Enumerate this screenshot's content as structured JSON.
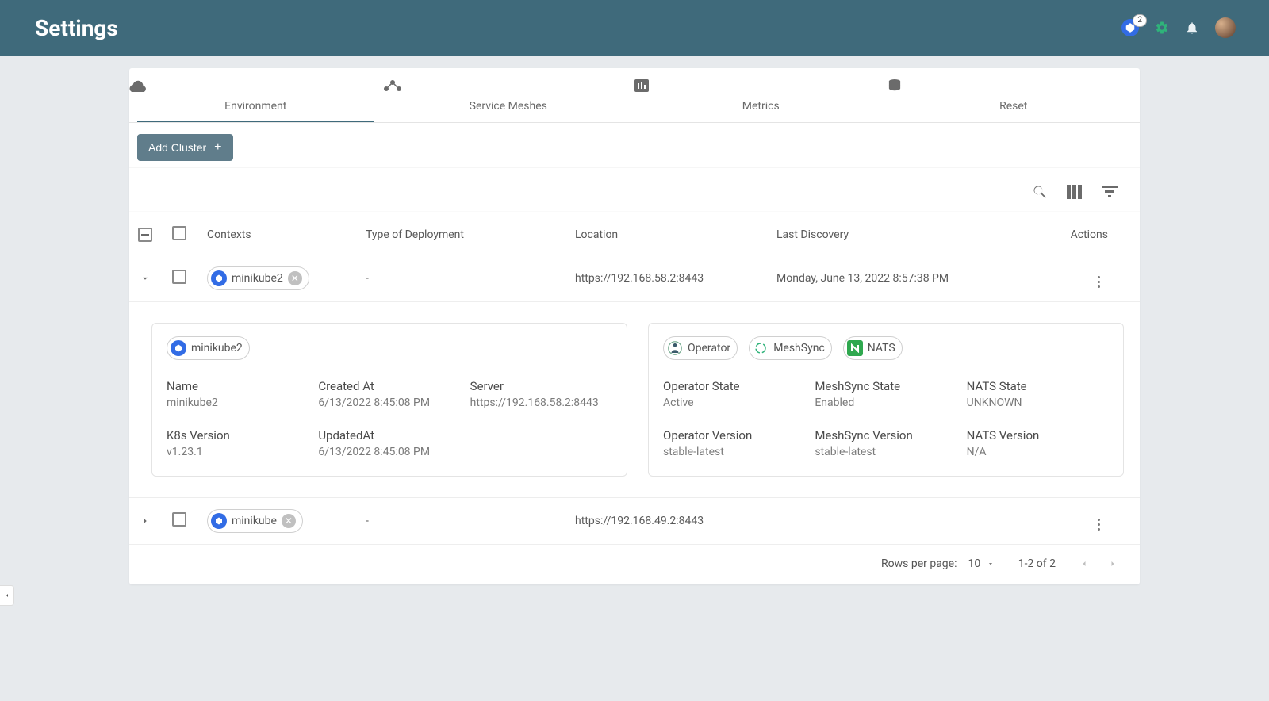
{
  "header": {
    "title": "Settings",
    "k8s_badge_count": "2"
  },
  "tabs": [
    {
      "label": "Environment"
    },
    {
      "label": "Service Meshes"
    },
    {
      "label": "Metrics"
    },
    {
      "label": "Reset"
    }
  ],
  "buttons": {
    "add_cluster": "Add Cluster"
  },
  "table": {
    "headers": {
      "contexts": "Contexts",
      "deployment": "Type of Deployment",
      "location": "Location",
      "discovery": "Last Discovery",
      "actions": "Actions"
    },
    "rows": [
      {
        "context": "minikube2",
        "deployment": "-",
        "location": "https://192.168.58.2:8443",
        "discovery": "Monday, June 13, 2022 8:57:38 PM",
        "expanded": true
      },
      {
        "context": "minikube",
        "deployment": "-",
        "location": "https://192.168.49.2:8443",
        "discovery": "",
        "expanded": false
      }
    ]
  },
  "details": {
    "left": {
      "chip": "minikube2",
      "name_label": "Name",
      "name_value": "minikube2",
      "created_label": "Created At",
      "created_value": "6/13/2022 8:45:08 PM",
      "server_label": "Server",
      "server_value": "https://192.168.58.2:8443",
      "k8s_label": "K8s Version",
      "k8s_value": "v1.23.1",
      "updated_label": "UpdatedAt",
      "updated_value": "6/13/2022 8:45:08 PM"
    },
    "right": {
      "chip_operator": "Operator",
      "chip_meshsync": "MeshSync",
      "chip_nats": "NATS",
      "op_state_label": "Operator State",
      "op_state_value": "Active",
      "ms_state_label": "MeshSync State",
      "ms_state_value": "Enabled",
      "nats_state_label": "NATS State",
      "nats_state_value": "UNKNOWN",
      "op_ver_label": "Operator Version",
      "op_ver_value": "stable-latest",
      "ms_ver_label": "MeshSync Version",
      "ms_ver_value": "stable-latest",
      "nats_ver_label": "NATS Version",
      "nats_ver_value": "N/A"
    }
  },
  "pager": {
    "rows_per_page_label": "Rows per page:",
    "rows_per_page_value": "10",
    "range": "1-2 of 2"
  }
}
